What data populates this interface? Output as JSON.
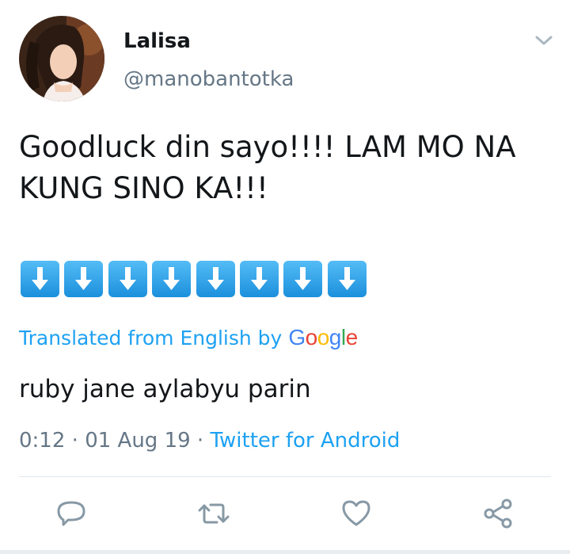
{
  "tweet": {
    "display_name": "Lalisa",
    "handle": "@manobantotka",
    "text_line1": "Goodluck din sayo!!!! LAM MO NA",
    "text_line2": "KUNG SINO KA!!!",
    "emoji_name": "down-arrow-emoji",
    "emoji_count": 8,
    "translated_label": "Translated from English by",
    "translation_provider": "Google",
    "translation": "ruby jane aylabyu parin",
    "time": "0:12",
    "date": "01 Aug 19",
    "separator": "·",
    "source": "Twitter for Android"
  },
  "actions": {
    "reply_icon": "reply-icon",
    "retweet_icon": "retweet-icon",
    "like_icon": "heart-icon",
    "share_icon": "share-icon"
  },
  "colors": {
    "link": "#1da1f2",
    "secondary": "#657786",
    "primary_text": "#14171a",
    "divider": "#e1e8ed",
    "google_blue": "#4285f4",
    "google_red": "#ea4335",
    "google_yellow": "#fbbc05",
    "google_green": "#34a853"
  }
}
